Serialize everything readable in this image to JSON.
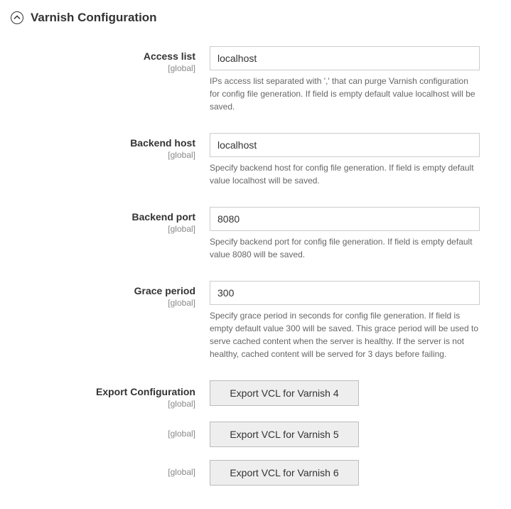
{
  "section": {
    "title": "Varnish Configuration"
  },
  "scope": "[global]",
  "fields": {
    "access_list": {
      "label": "Access list",
      "value": "localhost",
      "helper": "IPs access list separated with ',' that can purge Varnish configuration for config file generation. If field is empty default value localhost will be saved."
    },
    "backend_host": {
      "label": "Backend host",
      "value": "localhost",
      "helper": "Specify backend host for config file generation. If field is empty default value localhost will be saved."
    },
    "backend_port": {
      "label": "Backend port",
      "value": "8080",
      "helper": "Specify backend port for config file generation. If field is empty default value 8080 will be saved."
    },
    "grace_period": {
      "label": "Grace period",
      "value": "300",
      "helper": "Specify grace period in seconds for config file generation. If field is empty default value 300 will be saved. This grace period will be used to serve cached content when the server is healthy. If the server is not healthy, cached content will be served for 3 days before failing."
    },
    "export": {
      "label": "Export Configuration",
      "buttons": {
        "v4": "Export VCL for Varnish 4",
        "v5": "Export VCL for Varnish 5",
        "v6": "Export VCL for Varnish 6"
      }
    }
  }
}
